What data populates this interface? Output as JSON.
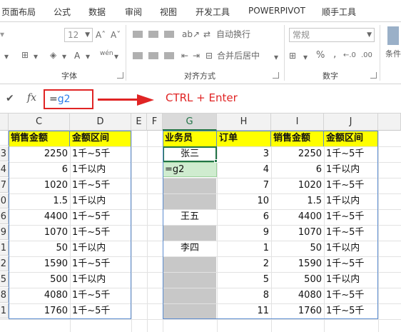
{
  "ribbon_tabs": [
    "页面布局",
    "公式",
    "数据",
    "审阅",
    "视图",
    "开发工具",
    "POWERPIVOT",
    "顺手工具"
  ],
  "ribbon": {
    "font_size_value": "12",
    "font_grow": "Aˆ",
    "font_shrink": "Aˇ",
    "phonetic": "wén",
    "font_color_glyph": "A",
    "font_group_label": "字体",
    "wrap_text_label": "自动换行",
    "merge_center_label": "合并后居中",
    "alignment_group_label": "对齐方式",
    "number_format_value": "常规",
    "percent": "%",
    "comma": ",",
    "decimal_inc": "←.0",
    "decimal_dec": ".00",
    "number_group_label": "数字",
    "conditional_label": "条件"
  },
  "formula_bar": {
    "cancel_glyph": "✔",
    "fx_glyph": "fx",
    "prefix": "=",
    "highlighted_ref": "g2",
    "annotation": "CTRL + Enter"
  },
  "column_headers": [
    "C",
    "D",
    "E",
    "F",
    "G",
    "H",
    "I",
    "J"
  ],
  "left_table": {
    "headers": [
      "销售金额",
      "金额区间"
    ],
    "row_stubs": [
      "3",
      "4",
      "7",
      "0",
      "6",
      "9",
      "1",
      "2",
      "5",
      "8",
      "1"
    ],
    "rows": [
      [
        "2250",
        "1千~5千"
      ],
      [
        "6",
        "1千以内"
      ],
      [
        "1020",
        "1千~5千"
      ],
      [
        "1.5",
        "1千以内"
      ],
      [
        "4400",
        "1千~5千"
      ],
      [
        "1070",
        "1千~5千"
      ],
      [
        "50",
        "1千以内"
      ],
      [
        "1590",
        "1千~5千"
      ],
      [
        "500",
        "1千以内"
      ],
      [
        "4080",
        "1千~5千"
      ],
      [
        "1760",
        "1千~5千"
      ]
    ]
  },
  "right_table": {
    "headers": [
      "业务员",
      "订单",
      "销售金额",
      "金额区间"
    ],
    "g_column": [
      "张三",
      "=g2",
      "",
      "",
      "王五",
      "",
      "李四",
      "",
      "",
      "",
      ""
    ],
    "rows": [
      [
        "3",
        "2250",
        "1千~5千"
      ],
      [
        "4",
        "6",
        "1千以内"
      ],
      [
        "7",
        "1020",
        "1千~5千"
      ],
      [
        "10",
        "1.5",
        "1千以内"
      ],
      [
        "6",
        "4400",
        "1千~5千"
      ],
      [
        "9",
        "1070",
        "1千~5千"
      ],
      [
        "1",
        "50",
        "1千以内"
      ],
      [
        "2",
        "1590",
        "1千~5千"
      ],
      [
        "5",
        "500",
        "1千以内"
      ],
      [
        "8",
        "4080",
        "1千~5千"
      ],
      [
        "11",
        "1760",
        "1千~5千"
      ]
    ]
  }
}
